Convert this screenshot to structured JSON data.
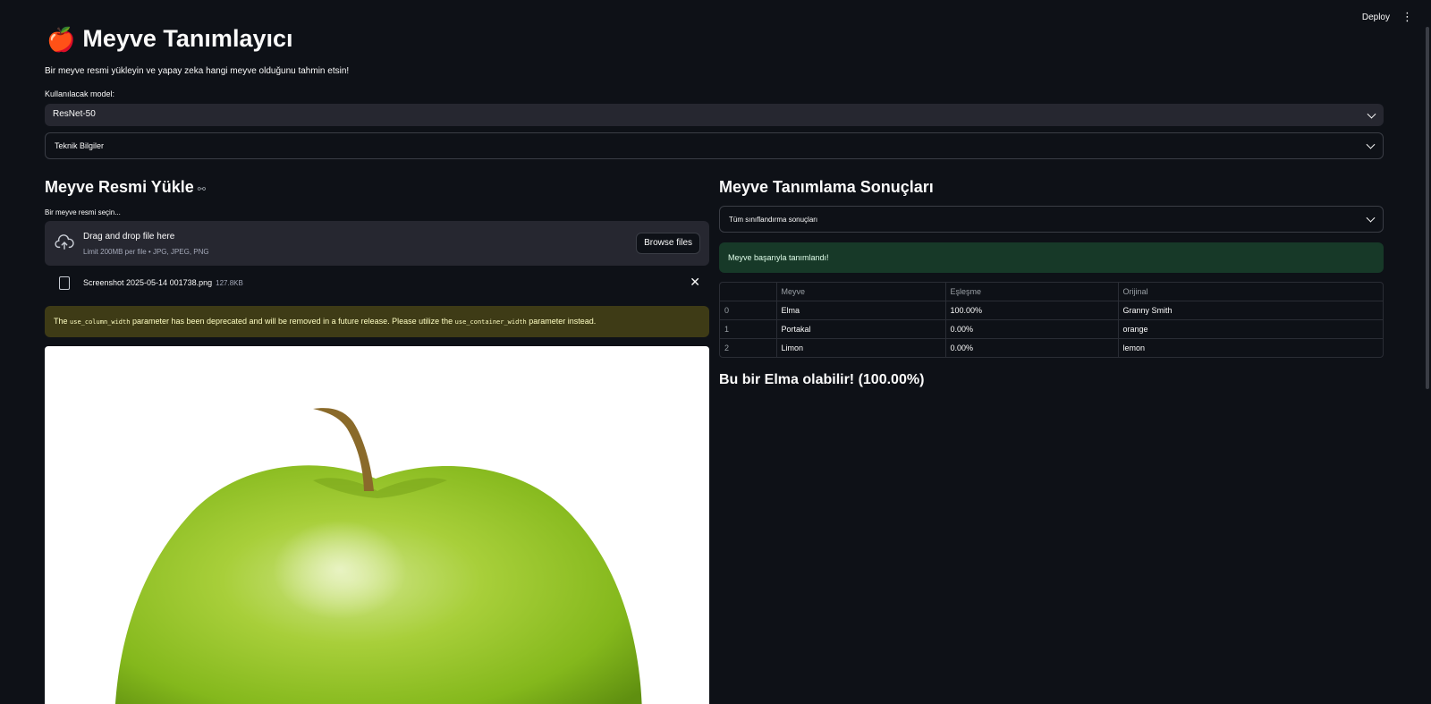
{
  "header": {
    "deploy_label": "Deploy",
    "menu_glyph": "⋮"
  },
  "app": {
    "emoji": "🍎",
    "title": "Meyve Tanımlayıcı",
    "subtitle": "Bir meyve resmi yükleyin ve yapay zeka hangi meyve olduğunu tahmin etsin!"
  },
  "model_select": {
    "label": "Kullanılacak model:",
    "value": "ResNet-50"
  },
  "tech_expander": {
    "label": "Teknik Bilgiler"
  },
  "upload": {
    "heading": "Meyve Resmi Yükle",
    "link_icon": "link-icon",
    "label": "Bir meyve resmi seçin...",
    "drop_title": "Drag and drop file here",
    "drop_limit": "Limit 200MB per file • JPG, JPEG, PNG",
    "browse_label": "Browse files",
    "file_name": "Screenshot 2025-05-14 001738.png",
    "file_size": "127.8KB",
    "remove_glyph": "✕"
  },
  "warning": {
    "before": "The ",
    "code1": "use_column_width",
    "middle": " parameter has been deprecated and will be removed in a future release. Please utilize the ",
    "code2": "use_container_width",
    "after": " parameter instead."
  },
  "results": {
    "heading": "Meyve Tanımlama Sonuçları",
    "expander_label": "Tüm sınıflandırma sonuçları",
    "success_text": "Meyve başarıyla tanımlandı!",
    "table": {
      "columns": [
        "",
        "Meyve",
        "Eşleşme",
        "Orijinal"
      ],
      "rows": [
        {
          "index": "0",
          "fruit": "Elma",
          "match": "100.00%",
          "original": "Granny Smith"
        },
        {
          "index": "1",
          "fruit": "Portakal",
          "match": "0.00%",
          "original": "orange"
        },
        {
          "index": "2",
          "fruit": "Limon",
          "match": "0.00%",
          "original": "lemon"
        }
      ]
    },
    "verdict": "Bu bir Elma olabilir! (100.00%)"
  },
  "colors": {
    "background": "#0e1117",
    "widget": "#262730",
    "warning_bg": "#3e3b16",
    "success_bg": "#173928",
    "apple_green": "#8fc31f"
  }
}
